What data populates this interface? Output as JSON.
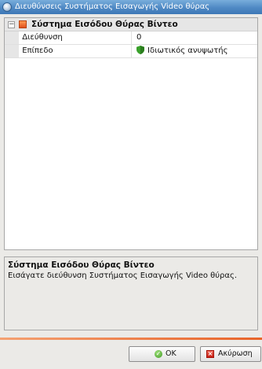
{
  "window": {
    "title": "Διευθύνσεις Συστήματος Εισαγωγής Video θύρας"
  },
  "property_grid": {
    "category": {
      "collapse_symbol": "−",
      "label": "Σύστημα Εισόδου Θύρας Βίντεο"
    },
    "rows": [
      {
        "name": "Διεύθυνση",
        "value": "0"
      },
      {
        "name": "Επίπεδο",
        "value": "Ιδιωτικός ανυψωτής",
        "value_icon": "green-shield-icon"
      }
    ]
  },
  "description": {
    "title": "Σύστημα Εισόδου Θύρας Βίντεο",
    "text": "Εισάγατε διεύθυνση Συστήματος Εισαγωγής Video θύρας."
  },
  "buttons": {
    "ok_label": "OK",
    "cancel_label": "Ακύρωση"
  },
  "colors": {
    "titlebar": "#4f89c4",
    "accent_line": "#e8642a",
    "category_icon": "#e0501c"
  }
}
